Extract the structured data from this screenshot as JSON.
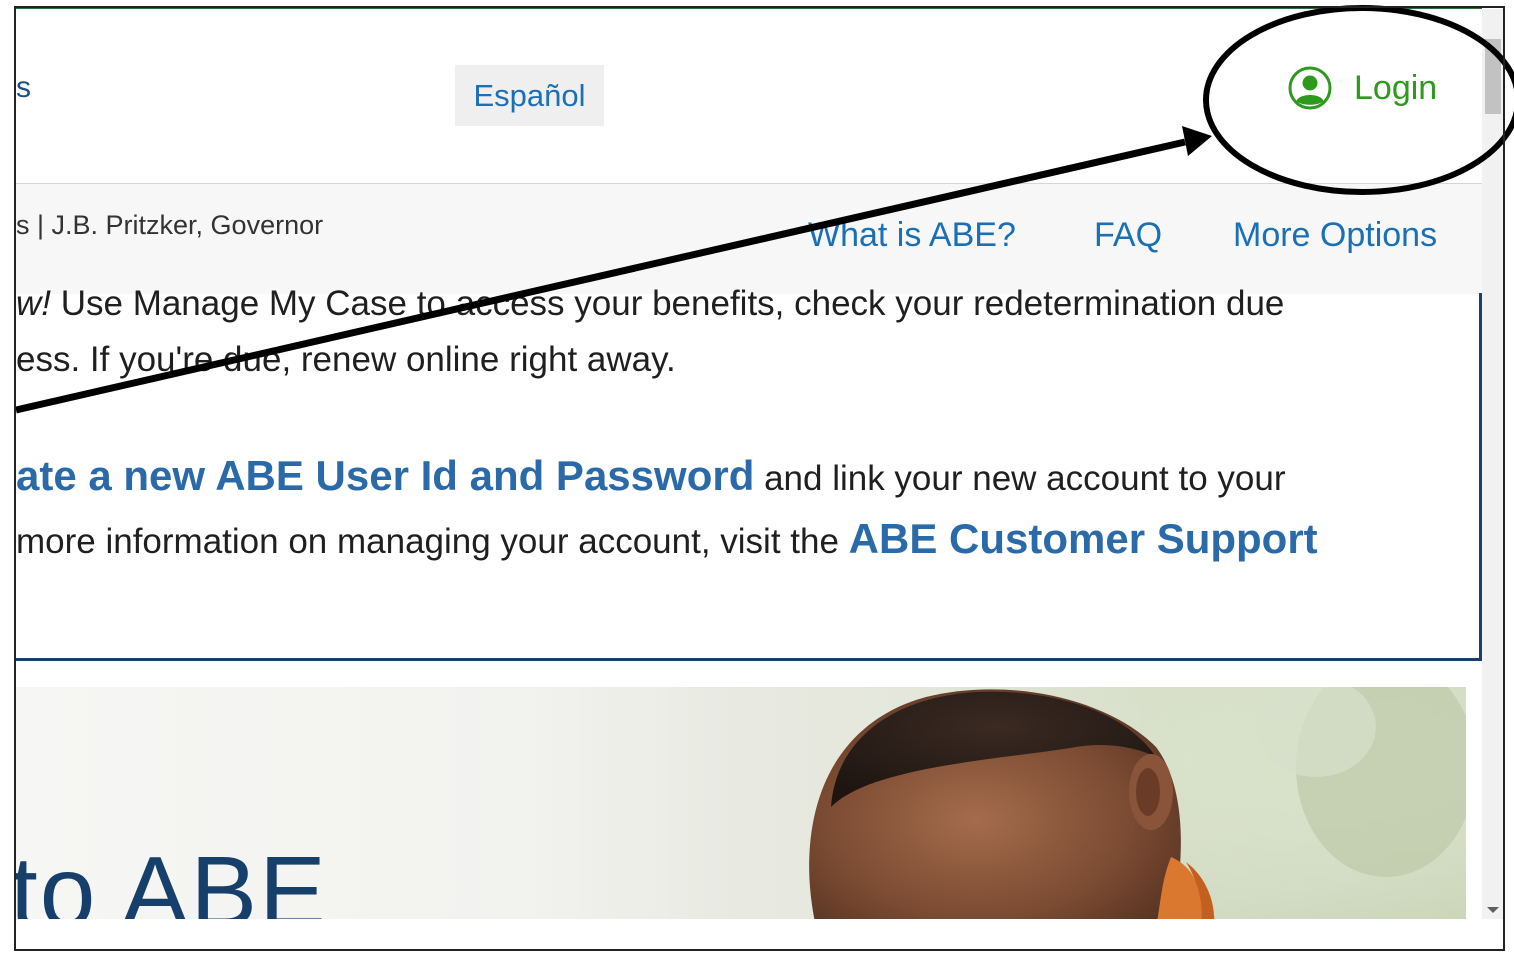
{
  "header": {
    "brand_fragment": "s",
    "espanol_label": "Español",
    "login_label": "Login"
  },
  "nav": {
    "agency_line": "s | J.B. Pritzker, Governor",
    "links": [
      "What is ABE?",
      "FAQ",
      "More Options"
    ]
  },
  "notice": {
    "line1_em": "w!",
    "line1_rest": " Use Manage My Case to access your benefits, check your redetermination due",
    "line2": "ess. If you're due, renew online right away.",
    "line3_link": "ate a new ABE User Id and Password",
    "line3_rest": " and link your new account to your",
    "line4_text": "more information on managing your account, visit the ",
    "line4_link": "ABE Customer Support"
  },
  "hero": {
    "title": "to ABE"
  },
  "colors": {
    "link_blue": "#1a6fb5",
    "login_green": "#2e9a1d",
    "navy": "#1b3f6b"
  }
}
